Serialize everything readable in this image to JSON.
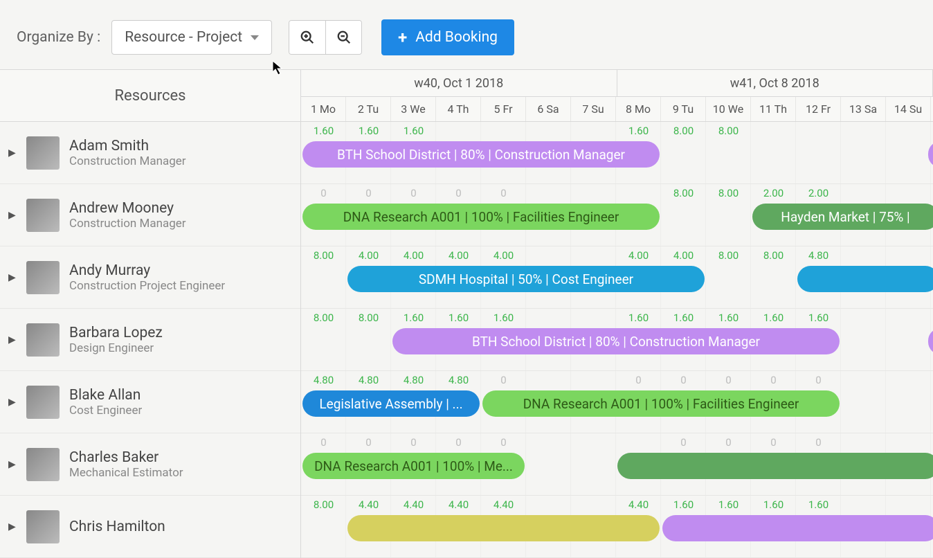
{
  "toolbar": {
    "organize_label": "Organize By :",
    "dropdown_value": "Resource - Project",
    "add_booking_label": "Add Booking"
  },
  "header": {
    "resources_label": "Resources",
    "weeks": [
      "w40, Oct 1 2018",
      "w41, Oct 8 2018"
    ],
    "days": [
      "1 Mo",
      "2 Tu",
      "3 We",
      "4 Th",
      "5 Fr",
      "6 Sa",
      "7 Su",
      "8 Mo",
      "9 Tu",
      "10 We",
      "11 Th",
      "12 Fr",
      "13 Sa",
      "14 Su"
    ]
  },
  "resources": [
    {
      "name": "Adam Smith",
      "role": "Construction Manager",
      "hours": [
        "1.60",
        "1.60",
        "1.60",
        "",
        "",
        "",
        "",
        "1.60",
        "8.00",
        "8.00",
        "",
        "",
        "",
        ""
      ],
      "hours_cls": [
        "g",
        "g",
        "g",
        "",
        "",
        "",
        "",
        "g",
        "g",
        "g",
        "",
        "",
        "",
        ""
      ],
      "bookings": [
        {
          "label": "BTH School District | 80% | Construction Manager",
          "start": 0,
          "span": 8,
          "cls": "c-purple"
        },
        {
          "label": "",
          "start": 13.9,
          "span": 0.3,
          "cls": "c-purple"
        }
      ]
    },
    {
      "name": "Andrew Mooney",
      "role": "Construction Manager",
      "hours": [
        "0",
        "0",
        "0",
        "0",
        "0",
        "",
        "",
        "",
        "8.00",
        "8.00",
        "2.00",
        "2.00",
        "",
        ""
      ],
      "hours_cls": [
        "x",
        "x",
        "x",
        "x",
        "x",
        "",
        "",
        "",
        "g",
        "g",
        "g",
        "g",
        "",
        ""
      ],
      "bookings": [
        {
          "label": "DNA Research A001 | 100% | Facilities Engineer",
          "start": 0,
          "span": 8,
          "cls": "c-green"
        },
        {
          "label": "Hayden Market | 75% |",
          "start": 10,
          "span": 4.2,
          "cls": "c-green-dark"
        }
      ]
    },
    {
      "name": "Andy Murray",
      "role": "Construction Project Engineer",
      "hours": [
        "8.00",
        "4.00",
        "4.00",
        "4.00",
        "4.00",
        "",
        "",
        "4.00",
        "4.00",
        "8.00",
        "8.00",
        "4.80",
        "",
        ""
      ],
      "hours_cls": [
        "g",
        "g",
        "g",
        "g",
        "g",
        "",
        "",
        "g",
        "g",
        "g",
        "g",
        "g",
        "",
        ""
      ],
      "bookings": [
        {
          "label": "SDMH Hospital | 50% | Cost Engineer",
          "start": 1,
          "span": 8,
          "cls": "c-blue"
        },
        {
          "label": "",
          "start": 11,
          "span": 3.2,
          "cls": "c-blue"
        }
      ]
    },
    {
      "name": "Barbara Lopez",
      "role": "Design Engineer",
      "hours": [
        "8.00",
        "8.00",
        "1.60",
        "1.60",
        "1.60",
        "",
        "",
        "1.60",
        "1.60",
        "1.60",
        "1.60",
        "1.60",
        "",
        ""
      ],
      "hours_cls": [
        "g",
        "g",
        "g",
        "g",
        "g",
        "",
        "",
        "g",
        "g",
        "g",
        "g",
        "g",
        "",
        ""
      ],
      "bookings": [
        {
          "label": "BTH School District | 80% | Construction Manager",
          "start": 2,
          "span": 10,
          "cls": "c-purple"
        },
        {
          "label": "",
          "start": 13.9,
          "span": 0.3,
          "cls": "c-purple"
        }
      ]
    },
    {
      "name": "Blake Allan",
      "role": "Cost Engineer",
      "hours": [
        "4.80",
        "4.80",
        "4.80",
        "4.80",
        "0",
        "",
        "",
        "0",
        "0",
        "0",
        "0",
        "0",
        "",
        ""
      ],
      "hours_cls": [
        "g",
        "g",
        "g",
        "g",
        "x",
        "",
        "",
        "x",
        "x",
        "x",
        "x",
        "x",
        "",
        ""
      ],
      "bookings": [
        {
          "label": "Legislative Assembly | ...",
          "start": 0,
          "span": 4,
          "cls": "c-blue-dark"
        },
        {
          "label": "DNA Research A001 | 100% | Facilities Engineer",
          "start": 4,
          "span": 8,
          "cls": "c-green"
        }
      ]
    },
    {
      "name": "Charles Baker",
      "role": "Mechanical Estimator",
      "hours": [
        "0",
        "0",
        "0",
        "0",
        "0",
        "",
        "",
        "",
        "0",
        "0",
        "0",
        "0",
        "",
        ""
      ],
      "hours_cls": [
        "x",
        "x",
        "x",
        "x",
        "x",
        "",
        "",
        "",
        "x",
        "x",
        "x",
        "x",
        "",
        ""
      ],
      "bookings": [
        {
          "label": "DNA Research A001 | 100% | Me...",
          "start": 0,
          "span": 5,
          "cls": "c-green"
        },
        {
          "label": "",
          "start": 7,
          "span": 7.2,
          "cls": "c-mystery"
        }
      ]
    },
    {
      "name": "Chris Hamilton",
      "role": "",
      "hours": [
        "8.00",
        "4.40",
        "4.40",
        "4.40",
        "4.40",
        "",
        "",
        "4.40",
        "1.60",
        "1.60",
        "1.60",
        "1.60",
        "",
        ""
      ],
      "hours_cls": [
        "g",
        "g",
        "g",
        "g",
        "g",
        "",
        "",
        "g",
        "g",
        "g",
        "g",
        "g",
        "",
        ""
      ],
      "bookings": [
        {
          "label": "",
          "start": 1,
          "span": 7,
          "cls": "c-yellow"
        },
        {
          "label": "",
          "start": 8,
          "span": 6.2,
          "cls": "c-purple"
        }
      ]
    }
  ]
}
